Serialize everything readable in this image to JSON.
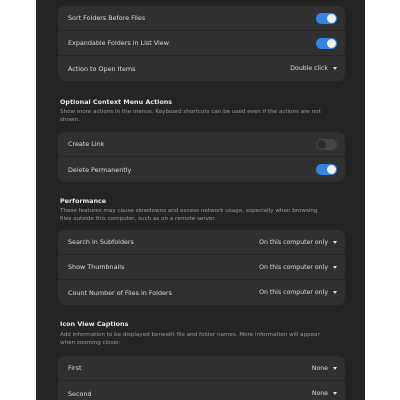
{
  "general": {
    "sort_folders_label": "Sort Folders Before Files",
    "sort_folders_on": true,
    "expandable_folders_label": "Expandable Folders in List View",
    "expandable_folders_on": true,
    "action_open_label": "Action to Open Items",
    "action_open_value": "Double click"
  },
  "context_menu": {
    "title": "Optional Context Menu Actions",
    "description": "Show more actions in the menus. Keyboard shortcuts can be used even if the actions are not shown.",
    "create_link_label": "Create Link",
    "create_link_on": false,
    "delete_permanently_label": "Delete Permanently",
    "delete_permanently_on": true
  },
  "performance": {
    "title": "Performance",
    "description": "These features may cause slowdowns and excess network usage, especially when browsing files outside this computer, such as on a remote server.",
    "rows": [
      {
        "label": "Search in Subfolders",
        "value": "On this computer only"
      },
      {
        "label": "Show Thumbnails",
        "value": "On this computer only"
      },
      {
        "label": "Count Number of Files in Folders",
        "value": "On this computer only"
      }
    ]
  },
  "icon_captions": {
    "title": "Icon View Captions",
    "description": "Add information to be displayed beneath file and folder names. More information will appear when zooming closer.",
    "rows": [
      {
        "label": "First",
        "value": "None"
      },
      {
        "label": "Second",
        "value": "None"
      }
    ]
  },
  "colors": {
    "background": "#242424",
    "group": "#303030",
    "accent": "#3584e4"
  }
}
